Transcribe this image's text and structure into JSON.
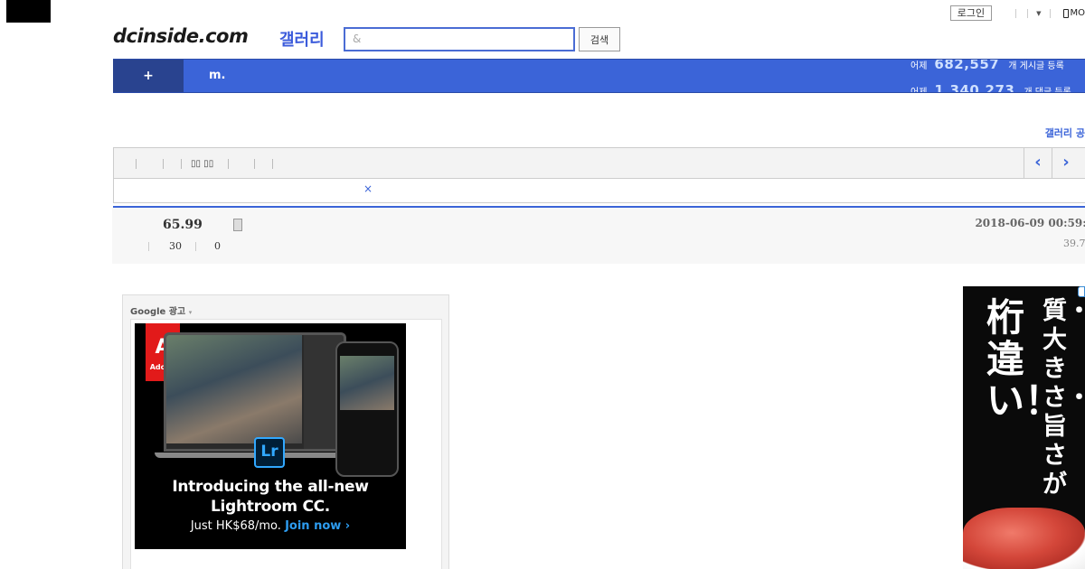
{
  "topbar": {
    "login_label": "로그인",
    "mobile_label": "MO"
  },
  "header": {
    "logo_text": "dcinside.com",
    "gallery_label": "갤러리",
    "search_value": "&",
    "search_button": "검색"
  },
  "nav": {
    "plus_label": "+",
    "m_label": "m.",
    "stats": [
      {
        "prefix": "어제",
        "value": "682,557",
        "suffix": "개 게시글 등록"
      },
      {
        "prefix": "어제",
        "value": "1,340,273",
        "suffix": "개 댓글 등록"
      }
    ]
  },
  "gallery_notice_link": "갤러리 공",
  "toolbar": {
    "boxes_label": "▯▯ ▯▯",
    "prev_label": "‹",
    "next_label": "›"
  },
  "notice": {
    "close_label": "×"
  },
  "post": {
    "title": "65.99",
    "date": "2018-06-09 00:59:0",
    "ip": "39.7.",
    "view_count": "30",
    "reply_count": "0"
  },
  "ads": {
    "google_label": "Google 광고",
    "google_caret": "▾",
    "adobe_logo_letter": "A",
    "adobe_logo_text": "Adobe",
    "lr_label": "Lr",
    "headline_line1": "Introducing the all-new",
    "headline_line2": "Lightroom CC.",
    "price_text": "Just HK$68/mo.",
    "join_text": "Join now ›",
    "right_ad_main": "桁違い！",
    "right_ad_side": "質・大きさ・旨さが"
  },
  "colors": {
    "accent": "#3b64d8",
    "nav_dark": "#29438f",
    "adobe_red": "#e21a1a",
    "lr_blue": "#31a8ff"
  }
}
